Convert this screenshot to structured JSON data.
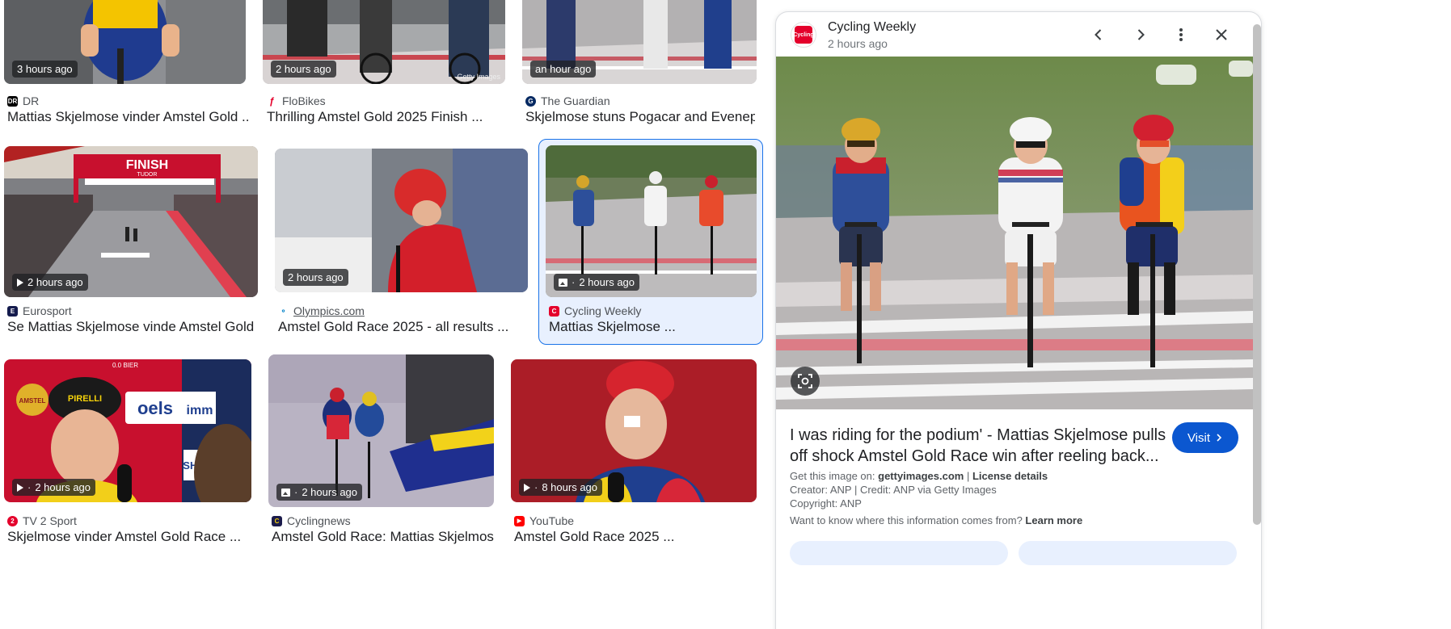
{
  "results": [
    {
      "time": "3 hours ago",
      "badge_icon": "none",
      "source": "DR",
      "title": "Mattias Skjelmose vinder Amstel Gold ...",
      "logo_color": "#000000"
    },
    {
      "time": "2 hours ago",
      "badge_icon": "none",
      "source": "FloBikes",
      "title": "Thrilling Amstel Gold 2025 Finish ...",
      "logo_color": "#e4002b",
      "watermark": "Getty Images"
    },
    {
      "time": "an hour ago",
      "badge_icon": "none",
      "source": "The Guardian",
      "title": "Skjelmose stuns Pogacar and Evenepo...",
      "logo_color": "#052962"
    },
    {
      "time": "2 hours ago",
      "badge_icon": "play-icon",
      "source": "Eurosport",
      "title": "Se Mattias Skjelmose vinde Amstel Gold ...",
      "logo_color": "#141b4d"
    },
    {
      "time": "2 hours ago",
      "badge_icon": "none",
      "source": "Olympics.com",
      "title": "Amstel Gold Race 2025 - all results ...",
      "logo_color": "#0081c8"
    },
    {
      "time": "2 hours ago",
      "badge_icon": "image-icon",
      "source": "Cycling Weekly",
      "title": "Mattias Skjelmose ...",
      "logo_color": "#e4002b"
    },
    {
      "time": "2 hours ago",
      "badge_icon": "play-icon",
      "source": "TV 2 Sport",
      "title": "Skjelmose vinder Amstel Gold Race ...",
      "logo_color": "#e4002b"
    },
    {
      "time": "2 hours ago",
      "badge_icon": "image-icon",
      "source": "Cyclingnews",
      "title": "Amstel Gold Race: Mattias Skjelmose ...",
      "logo_color": "#1b1b4b"
    },
    {
      "time": "8 hours ago",
      "badge_icon": "play-icon",
      "source": "YouTube",
      "title": "Amstel Gold Race 2025 ...",
      "logo_color": "#ff0000"
    }
  ],
  "thumb_text": {
    "finish_banner": "FINISH",
    "finish_sub": "TUDOR",
    "amstel_left": "AMSTEL",
    "pirelli": "PIRELLI",
    "oels": "oels",
    "shimano": "SHIMANO",
    "immo": "imm",
    "bier": "0.0 BIER"
  },
  "panel": {
    "source_name": "Cycling Weekly",
    "logo_text": "Cycling",
    "time": "2 hours ago",
    "title": "I was riding for the podium' - Mattias Skjelmose pulls off shock Amstel Gold Race win after reeling back...",
    "visit_label": "Visit",
    "get_image_prefix": "Get this image on: ",
    "get_image_site": "gettyimages.com",
    "separator": " | ",
    "license": "License details",
    "creator": "Creator: ANP | Credit: ANP via Getty Images",
    "copyright": "Copyright: ANP",
    "info_question": "Want to know where this information comes from? ",
    "learn_more": "Learn more"
  },
  "colors": {
    "accent": "#1a73e8",
    "visit_button": "#0b57d0",
    "selected_bg": "#e8f0fe"
  }
}
